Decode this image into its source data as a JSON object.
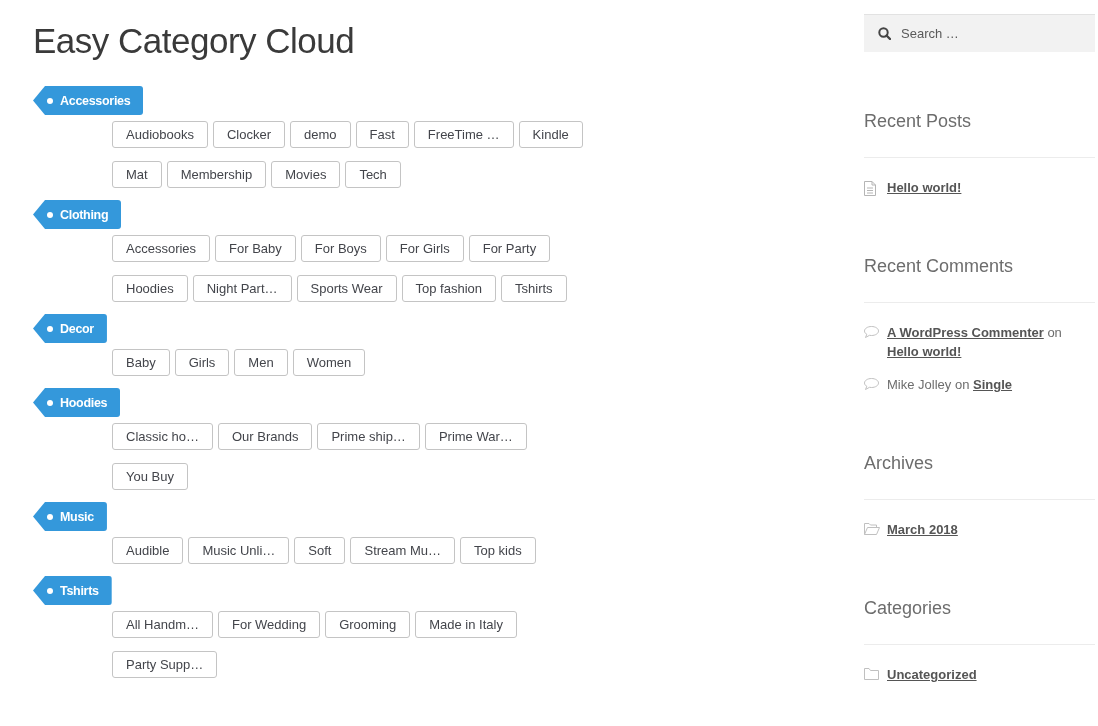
{
  "page": {
    "title": "Easy Category Cloud"
  },
  "category_cloud": [
    {
      "name": "Accessories",
      "children": [
        "Audiobooks",
        "Clocker",
        "demo",
        "Fast",
        "FreeTime …",
        "Kindle",
        "Mat",
        "Membership",
        "Movies",
        "Tech"
      ]
    },
    {
      "name": "Clothing",
      "children": [
        "Accessories",
        "For Baby",
        "For Boys",
        "For Girls",
        "For Party",
        "Hoodies",
        "Night Part…",
        "Sports Wear",
        "Top fashion",
        "Tshirts"
      ]
    },
    {
      "name": "Decor",
      "children": [
        "Baby",
        "Girls",
        "Men",
        "Women"
      ]
    },
    {
      "name": "Hoodies",
      "children": [
        "Classic ho…",
        "Our Brands",
        "Prime ship…",
        "Prime War…",
        "You Buy"
      ]
    },
    {
      "name": "Music",
      "children": [
        "Audible",
        "Music Unli…",
        "Soft",
        "Stream Mu…",
        "Top kids"
      ]
    },
    {
      "name": "Tshirts",
      "children": [
        "All Handm…",
        "For Wedding",
        "Grooming",
        "Made in Italy",
        "Party Supp…"
      ]
    }
  ],
  "sidebar": {
    "search": {
      "placeholder": "Search …"
    },
    "widgets": [
      {
        "kind": "posts",
        "title": "Recent Posts",
        "items": [
          {
            "label": "Hello world!"
          }
        ]
      },
      {
        "kind": "comments",
        "title": "Recent Comments",
        "items": [
          {
            "author": "A WordPress Commenter",
            "author_linked": true,
            "connector": "on",
            "post": "Hello world!"
          },
          {
            "author": "Mike Jolley",
            "author_linked": false,
            "connector": "on",
            "post": "Single"
          }
        ]
      },
      {
        "kind": "archives",
        "title": "Archives",
        "items": [
          {
            "label": "March 2018"
          }
        ]
      },
      {
        "kind": "categories",
        "title": "Categories",
        "items": [
          {
            "label": "Uncategorized"
          }
        ]
      }
    ]
  }
}
